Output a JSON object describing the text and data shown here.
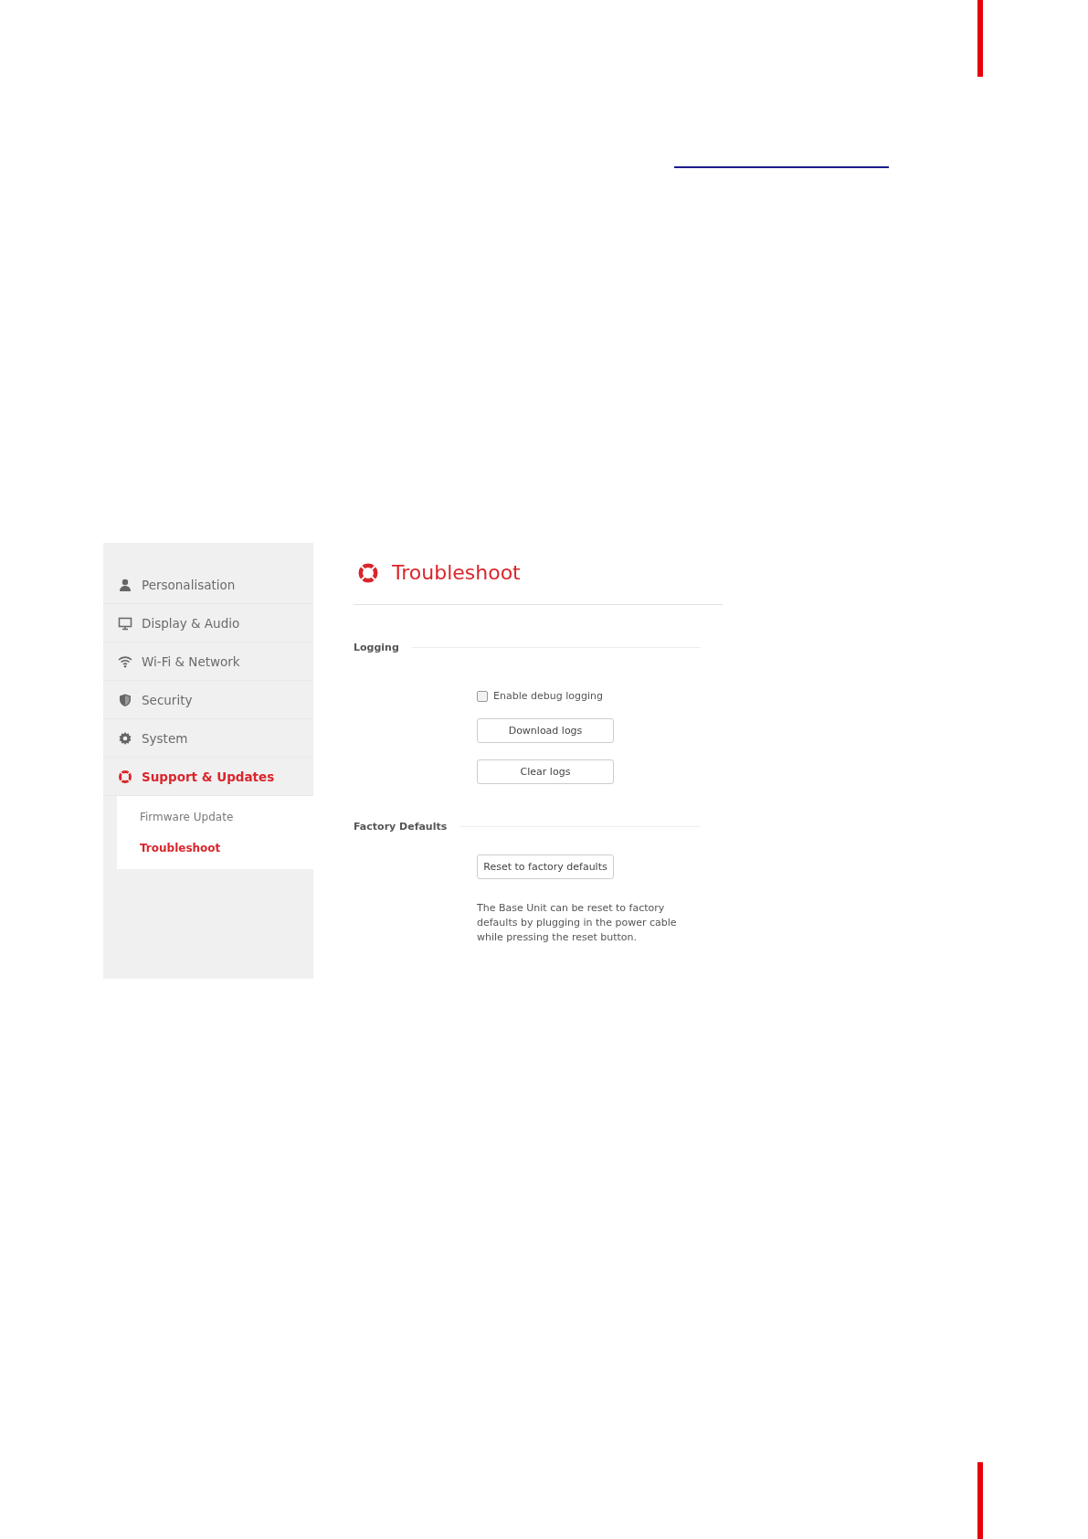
{
  "sidebar": {
    "items": [
      {
        "label": "Personalisation",
        "selected": false
      },
      {
        "label": "Display & Audio",
        "selected": false
      },
      {
        "label": "Wi-Fi & Network",
        "selected": false
      },
      {
        "label": "Security",
        "selected": false
      },
      {
        "label": "System",
        "selected": false
      },
      {
        "label": "Support & Updates",
        "selected": true,
        "children": [
          {
            "label": "Firmware Update",
            "selected": false
          },
          {
            "label": "Troubleshoot",
            "selected": true
          }
        ]
      }
    ]
  },
  "page": {
    "title": "Troubleshoot",
    "sections": [
      {
        "heading": "Logging",
        "controls": [
          {
            "kind": "checkbox",
            "label": "Enable debug logging",
            "checked": false
          },
          {
            "kind": "button",
            "label": "Download logs"
          },
          {
            "kind": "button",
            "label": "Clear logs"
          }
        ]
      },
      {
        "heading": "Factory Defaults",
        "controls": [
          {
            "kind": "button",
            "label": "Reset to factory defaults"
          },
          {
            "kind": "note",
            "text": "The Base Unit can be reset to factory defaults by plugging in the power cable while pressing the reset button."
          }
        ]
      }
    ]
  }
}
